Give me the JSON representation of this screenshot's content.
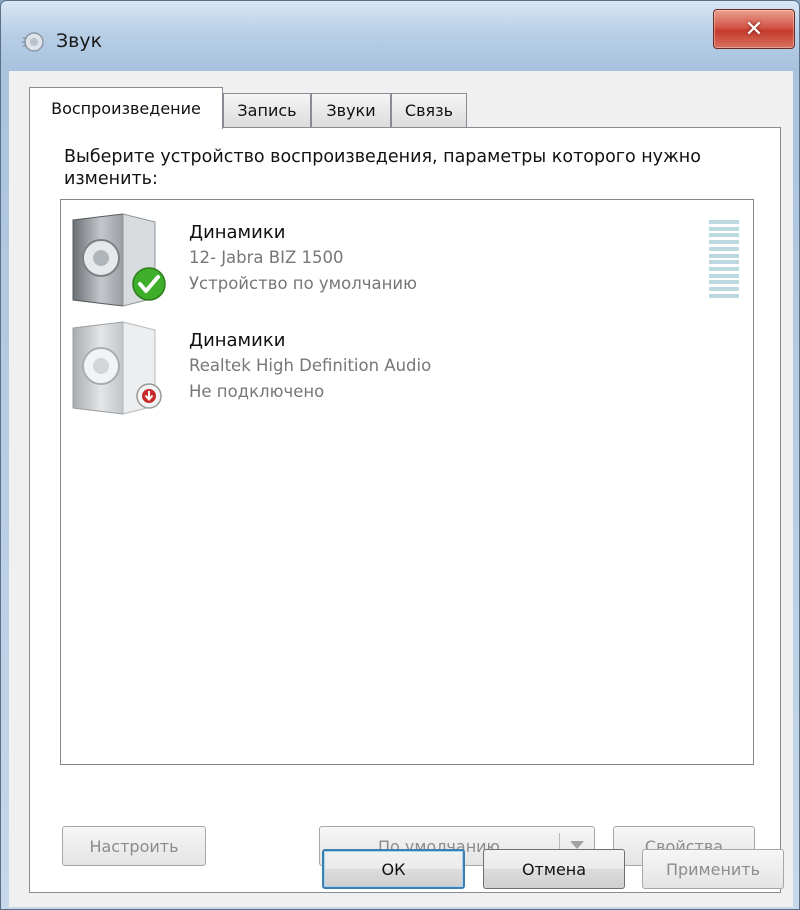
{
  "window": {
    "title": "Звук",
    "close_icon": "close-icon"
  },
  "tabs": [
    {
      "label": "Воспроизведение",
      "active": true
    },
    {
      "label": "Запись",
      "active": false
    },
    {
      "label": "Звуки",
      "active": false
    },
    {
      "label": "Связь",
      "active": false
    }
  ],
  "panel": {
    "instruction": "Выберите устройство воспроизведения, параметры которого нужно изменить:"
  },
  "devices": [
    {
      "name": "Динамики",
      "model": "12- Jabra BIZ 1500",
      "status": "Устройство по умолчанию",
      "icon": "speaker-icon",
      "badge": "check-icon",
      "level": 0
    },
    {
      "name": "Динамики",
      "model": "Realtek High Definition Audio",
      "status": "Не подключено",
      "icon": "speaker-icon",
      "badge": "disconnected-icon"
    }
  ],
  "panel_buttons": {
    "configure": "Настроить",
    "set_default": "По умолчанию",
    "properties": "Свойства"
  },
  "dialog_buttons": {
    "ok": "ОК",
    "cancel": "Отмена",
    "apply": "Применить"
  },
  "colors": {
    "check_green": "#3fae2a",
    "disconnected_red": "#c62a2a",
    "meter": "#bcd8e0",
    "default_button_border": "#3c7fb1"
  }
}
